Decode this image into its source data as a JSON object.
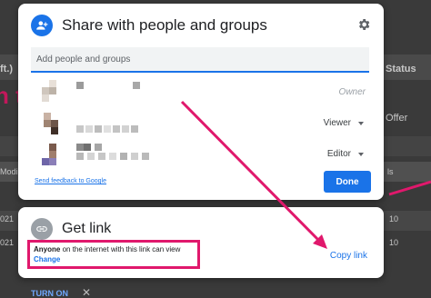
{
  "background": {
    "col_ft": "ft.)",
    "col_status": "Status",
    "col_offer": "Offer",
    "col_modi": "Modi",
    "row_021a": "021",
    "row_021b": "021",
    "pink_text": "n t",
    "turn_on": "TURN ON",
    "close_glyph": "✕",
    "col_ls": "ls",
    "right_num1": "10",
    "right_num2": "10"
  },
  "share": {
    "title": "Share with people and groups",
    "add_placeholder": "Add people and groups",
    "people": [
      {
        "role": "Owner"
      },
      {
        "role": "Viewer"
      },
      {
        "role": "Editor"
      }
    ],
    "feedback_label": "Send feedback to Google",
    "done_label": "Done"
  },
  "link": {
    "title": "Get link",
    "access_bold": "Anyone",
    "access_rest": " on the internet with this link can view",
    "change_label": "Change",
    "copy_label": "Copy link"
  },
  "colors": {
    "accent": "#1a73e8",
    "annotation": "#e0186c"
  },
  "icons": {
    "share_icon": "person-add-icon",
    "settings_icon": "gear-icon",
    "link_icon": "link-icon"
  }
}
